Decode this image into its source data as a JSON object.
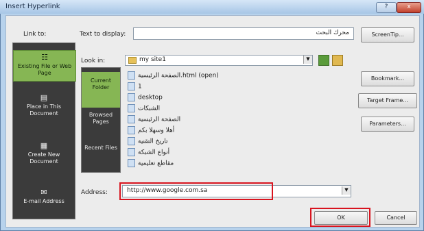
{
  "window": {
    "title": "Insert Hyperlink",
    "help_glyph": "?",
    "close_glyph": "x"
  },
  "labels": {
    "link_to": "Link to:",
    "text_to_display": "Text to display:",
    "look_in": "Look in:",
    "address": "Address:"
  },
  "text_to_display_value": "محرك البحث",
  "look_in_value": "my site1",
  "address_value": "http://www.google.com.sa",
  "link_to_items": [
    {
      "label": "Existing File or Web Page",
      "icon": "globe-page-icon",
      "selected": true
    },
    {
      "label": "Place in This Document",
      "icon": "document-icon",
      "selected": false
    },
    {
      "label": "Create New Document",
      "icon": "new-document-icon",
      "selected": false
    },
    {
      "label": "E-mail Address",
      "icon": "mail-icon",
      "selected": false
    }
  ],
  "side_items": [
    {
      "label": "Current Folder",
      "selected": true
    },
    {
      "label": "Browsed Pages",
      "selected": false
    },
    {
      "label": "Recent Files",
      "selected": false
    }
  ],
  "files": [
    "الصفحة الرئيسية.html (open)",
    "1",
    "desktop",
    "الشبكات",
    "الصفحة الرئيسية",
    "أهلا وسهلا بكم",
    "تاريخ التقنية",
    "أنواع الشبكة",
    "مقاطع تعليمية"
  ],
  "right_buttons": {
    "screentip": "ScreenTip...",
    "bookmark": "Bookmark...",
    "target_frame": "Target Frame...",
    "parameters": "Parameters..."
  },
  "ok_label": "OK",
  "cancel_label": "Cancel",
  "colors": {
    "selected_green": "#86b654",
    "highlight_red": "#d8141f"
  }
}
